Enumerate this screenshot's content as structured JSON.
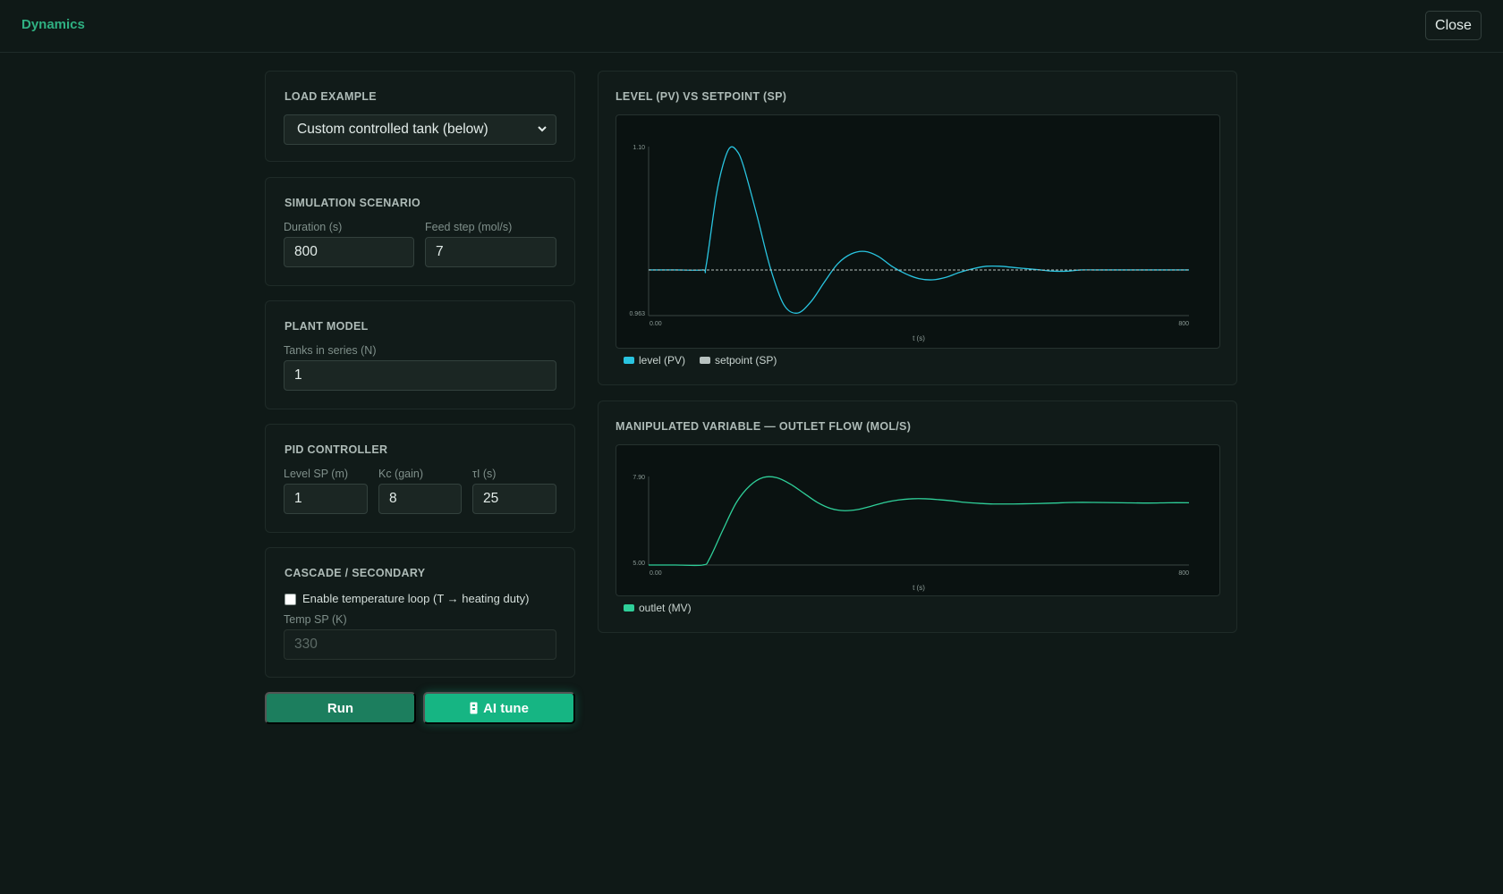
{
  "header": {
    "title": "Dynamics",
    "close_label": "Close"
  },
  "load_example": {
    "title": "LOAD EXAMPLE",
    "selected": "Custom controlled tank (below)"
  },
  "scenario": {
    "title": "SIMULATION SCENARIO",
    "duration_label": "Duration (s)",
    "duration_value": "800",
    "feed_label": "Feed step (mol/s)",
    "feed_value": "7"
  },
  "plant": {
    "title": "PLANT MODEL",
    "tanks_label": "Tanks in series (N)",
    "tanks_value": "1"
  },
  "pid": {
    "title": "PID CONTROLLER",
    "sp_label": "Level SP (m)",
    "sp_value": "1",
    "kc_label": "Kc (gain)",
    "kc_value": "8",
    "ti_label": "τI (s)",
    "ti_value": "25"
  },
  "cascade": {
    "title": "CASCADE / SECONDARY",
    "enable_label": "Enable temperature loop (T → heating duty)",
    "enabled": false,
    "temp_label": "Temp SP (K)",
    "temp_placeholder": "330"
  },
  "actions": {
    "run_label": "Run",
    "ai_label": "AI tune"
  },
  "colors": {
    "accent": "#16b583",
    "level": "#29c4e0",
    "setpoint": "#b8c2c0",
    "outlet": "#2fcf99"
  },
  "chart_data": [
    {
      "type": "line",
      "title": "LEVEL (PV) VS SETPOINT (SP)",
      "xlabel": "t (s)",
      "ylabel": "",
      "xlim": [
        0,
        800
      ],
      "ylim": [
        0.963,
        1.1
      ],
      "x_ticks": [
        "0.00",
        "800"
      ],
      "y_ticks": [
        "0.963",
        "1.10"
      ],
      "legend": "bottom-left",
      "series": [
        {
          "name": "level (PV)",
          "color": "#29c4e0",
          "x": [
            0,
            40,
            80,
            85,
            100,
            110,
            120,
            130,
            140,
            160,
            180,
            200,
            220,
            240,
            260,
            280,
            300,
            320,
            340,
            360,
            380,
            400,
            420,
            440,
            460,
            480,
            500,
            520,
            540,
            560,
            580,
            600,
            620,
            640,
            660,
            680,
            700,
            720,
            740,
            760,
            780,
            800
          ],
          "y": [
            1.0,
            1.0,
            1.0,
            1.003,
            1.06,
            1.085,
            1.099,
            1.097,
            1.085,
            1.045,
            1.002,
            0.972,
            0.965,
            0.974,
            0.99,
            1.005,
            1.013,
            1.015,
            1.011,
            1.003,
            0.997,
            0.993,
            0.992,
            0.994,
            0.998,
            1.001,
            1.003,
            1.003,
            1.002,
            1.001,
            1.0,
            0.999,
            0.999,
            1.0,
            1.0,
            1.0,
            1.0,
            1.0,
            1.0,
            1.0,
            1.0,
            1.0
          ]
        },
        {
          "name": "setpoint (SP)",
          "color": "#b8c2c0",
          "x": [
            0,
            800
          ],
          "y": [
            1.0,
            1.0
          ]
        }
      ]
    },
    {
      "type": "line",
      "title": "MANIPULATED VARIABLE — OUTLET FLOW (MOL/S)",
      "xlabel": "t (s)",
      "ylabel": "",
      "xlim": [
        0,
        800
      ],
      "ylim": [
        5.0,
        7.9
      ],
      "x_ticks": [
        "0.00",
        "800"
      ],
      "y_ticks": [
        "5.00",
        "7.90"
      ],
      "legend": "bottom-left",
      "series": [
        {
          "name": "outlet (MV)",
          "color": "#2fcf99",
          "x": [
            0,
            40,
            80,
            90,
            110,
            130,
            150,
            170,
            190,
            210,
            230,
            250,
            270,
            290,
            310,
            330,
            350,
            370,
            390,
            410,
            430,
            450,
            470,
            490,
            510,
            540,
            570,
            600,
            630,
            660,
            700,
            740,
            770,
            800
          ],
          "y": [
            5.0,
            5.0,
            5.0,
            5.2,
            6.15,
            7.05,
            7.6,
            7.87,
            7.86,
            7.65,
            7.35,
            7.05,
            6.85,
            6.78,
            6.82,
            6.93,
            7.05,
            7.13,
            7.17,
            7.17,
            7.14,
            7.1,
            7.05,
            7.02,
            7.0,
            7.0,
            7.01,
            7.03,
            7.05,
            7.05,
            7.04,
            7.03,
            7.04,
            7.04
          ]
        }
      ]
    }
  ]
}
